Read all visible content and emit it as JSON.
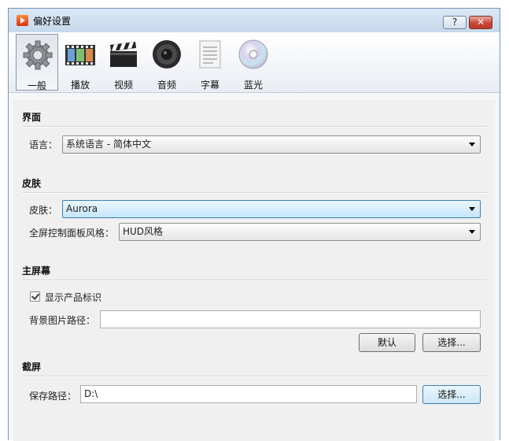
{
  "window": {
    "title": "偏好设置",
    "help_button": "?",
    "close_button": "✕"
  },
  "toolbar": {
    "tabs": [
      {
        "label": "一般",
        "icon": "gear-icon"
      },
      {
        "label": "播放",
        "icon": "film-strip-icon"
      },
      {
        "label": "视频",
        "icon": "clapperboard-icon"
      },
      {
        "label": "音频",
        "icon": "speaker-icon"
      },
      {
        "label": "字幕",
        "icon": "document-icon"
      },
      {
        "label": "蓝光",
        "icon": "disc-icon"
      }
    ],
    "active_tab": "一般"
  },
  "interface": {
    "section_title": "界面",
    "language_label": "语言：",
    "language_value": "系统语言 - 简体中文"
  },
  "skin": {
    "section_title": "皮肤",
    "skin_label": "皮肤：",
    "skin_value": "Aurora",
    "hud_label": "全屏控制面板风格：",
    "hud_value": "HUD风格"
  },
  "main_screen": {
    "section_title": "主屏幕",
    "show_logo_label": "显示产品标识",
    "show_logo_checked": true,
    "bg_path_label": "背景图片路径：",
    "bg_path_value": "",
    "default_button": "默认",
    "choose_button": "选择..."
  },
  "screenshot": {
    "section_title": "截屏",
    "save_path_label": "保存路径：",
    "save_path_value": "D:\\",
    "choose_button": "选择..."
  }
}
